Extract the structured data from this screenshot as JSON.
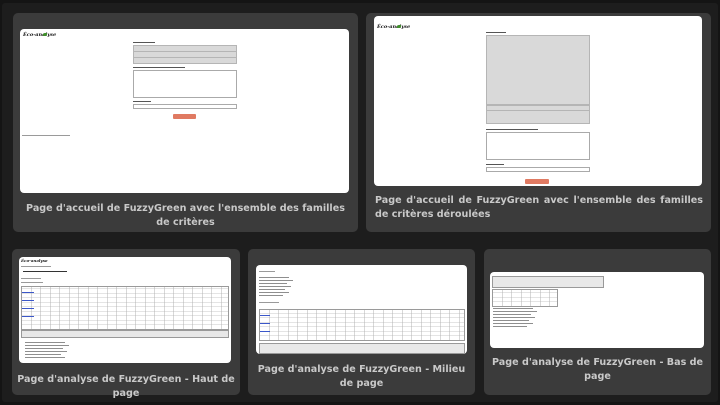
{
  "gallery": {
    "items": [
      {
        "caption": "Page d'accueil de FuzzyGreen avec l'ensemble des familles de critères"
      },
      {
        "caption": "Page d'accueil de FuzzyGreen avec l'ensemble des familles de critères déroulées"
      },
      {
        "caption": "Page d'analyse de FuzzyGreen - Haut de page"
      },
      {
        "caption": "Page d'analyse de FuzzyGreen - Milieu de page"
      },
      {
        "caption": "Page d'analyse de FuzzyGreen - Bas de page"
      }
    ]
  },
  "colors": {
    "background": "#141414",
    "card": "#3b3b3b",
    "caption_text": "#c9c9c9",
    "accent_button": "#e07a62",
    "logo_leaf": "#3f8f2a"
  }
}
